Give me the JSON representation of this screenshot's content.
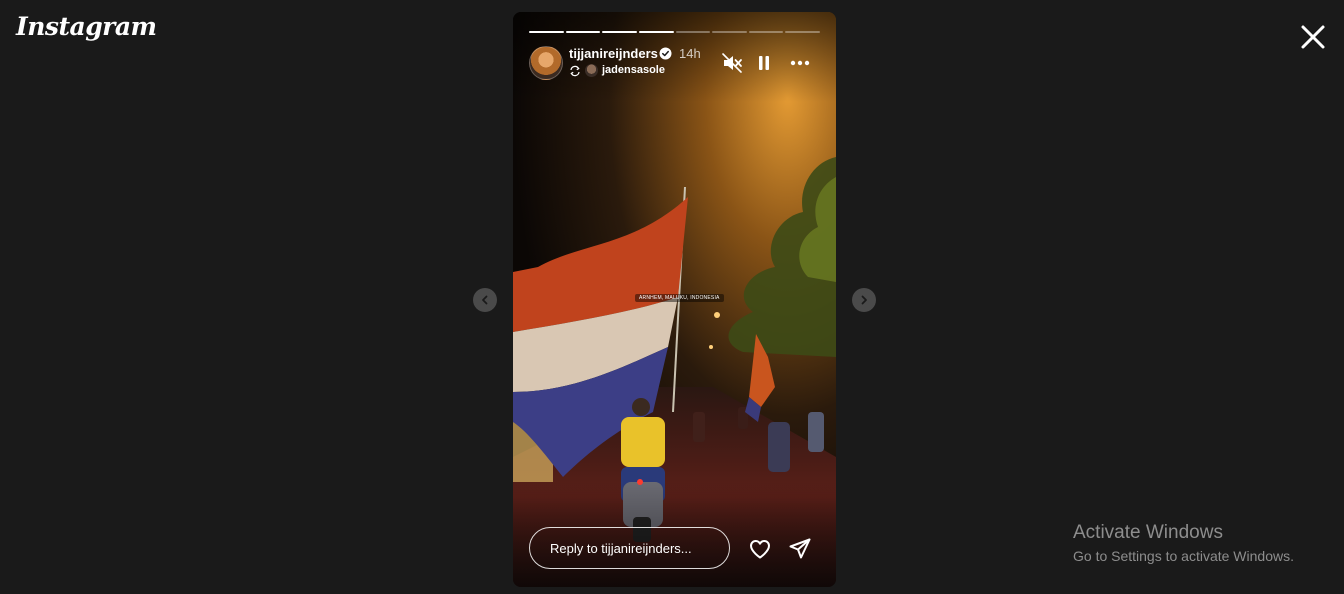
{
  "app": {
    "logo_text": "Instagram"
  },
  "story": {
    "progress_total": 8,
    "progress_completed": 4,
    "author": {
      "username": "tijjanireijnders",
      "verified": true,
      "time_ago": "14h"
    },
    "repost": {
      "username": "jadensasole"
    },
    "location_sticker": "ARNHEM, MALUKU, INDONESIA",
    "reply_placeholder": "Reply to tijjanireijnders..."
  },
  "icons": {
    "close": "close-icon",
    "mute": "speaker-muted-icon",
    "pause": "pause-icon",
    "more": "more-options-icon",
    "like": "heart-icon",
    "share": "send-icon",
    "prev": "chevron-left-icon",
    "next": "chevron-right-icon"
  },
  "watermark": {
    "title": "Activate Windows",
    "subtitle": "Go to Settings to activate Windows."
  }
}
